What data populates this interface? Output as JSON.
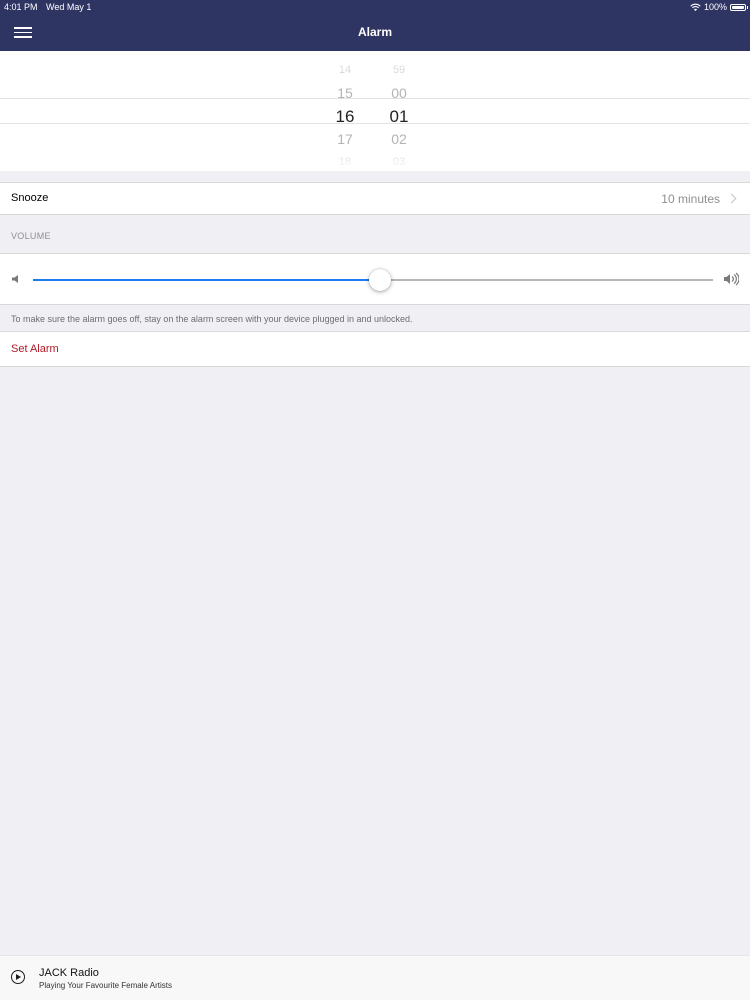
{
  "status_bar": {
    "time": "4:01 PM",
    "date": "Wed May 1",
    "battery": "100%"
  },
  "nav": {
    "title": "Alarm",
    "menu_icon": "hamburger-menu-icon"
  },
  "time_picker": {
    "hours": [
      "14",
      "15",
      "16",
      "17",
      "18"
    ],
    "minutes": [
      "59",
      "00",
      "01",
      "02",
      "03"
    ],
    "selected_hour": "16",
    "selected_minute": "01"
  },
  "snooze": {
    "label": "Snooze",
    "value": "10 minutes"
  },
  "volume": {
    "section_header": "VOLUME",
    "level": 0.51,
    "accent_color": "#1a7cf0"
  },
  "footer_note": "To make sure the alarm goes off, stay on the alarm screen with your device plugged in and unlocked.",
  "set_alarm": {
    "label": "Set Alarm",
    "color": "#b01b27"
  },
  "player": {
    "title": "JACK Radio",
    "subtitle": "Playing Your Favourite Female Artists",
    "icon": "play-circle-icon"
  },
  "colors": {
    "nav_background": "#2f3563",
    "page_background": "#efeff4"
  }
}
